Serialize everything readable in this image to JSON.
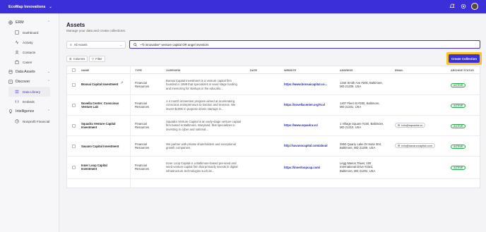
{
  "topbar": {
    "org_name": "EcoMap Innovations",
    "brand_color": "#3b2fd9"
  },
  "sidebar": {
    "sections": [
      {
        "label": "ERM",
        "icon": "globe-icon",
        "items": [
          {
            "label": "Dashboard",
            "icon": "dashboard-icon"
          },
          {
            "label": "Activity",
            "icon": "activity-icon"
          },
          {
            "label": "Contacts",
            "icon": "contacts-icon"
          },
          {
            "label": "Cases",
            "icon": "cases-icon"
          }
        ]
      },
      {
        "label": "Data Assets",
        "icon": "database-icon",
        "items": []
      },
      {
        "label": "Discover",
        "icon": "discover-icon",
        "items": [
          {
            "label": "Data Library",
            "icon": "library-icon",
            "active": true
          },
          {
            "label": "Embeds",
            "icon": "embed-icon"
          }
        ]
      },
      {
        "label": "Intelligence",
        "icon": "bulb-icon",
        "items": [
          {
            "label": "Nonprofit Financial",
            "icon": "chart-icon"
          }
        ]
      }
    ]
  },
  "page": {
    "title": "Assets",
    "subtitle": "Manage your data and create collections."
  },
  "filter": {
    "selected": "All Assets"
  },
  "search": {
    "value": "~\"b innovative\" venture capital OR angel investors"
  },
  "toolbar": {
    "columns_label": "Columns",
    "filter_label": "Filter",
    "create_label": "Create Collection"
  },
  "table": {
    "headers": {
      "name": "NAME",
      "type": "TYPE",
      "overview": "OVERVIEW",
      "date": "DATE",
      "website": "WEBSITE",
      "address": "ADDRESS",
      "email": "EMAIL",
      "status": "ARCHIVE STATUS"
    },
    "rows": [
      {
        "name": "Bonsai Capital Investment",
        "type": "Financial Resources",
        "overview": "Bonsai Capital Investment is a venture capital firm founded in 1999 that specializes in seed stage funding and mentoring for startups in the educatio...",
        "website": "https://www.bonsaicapital.co...",
        "address": "1340 Smith Ave #200, Baltimore, MD 21209, USA",
        "email": "",
        "status": "ACTIVE"
      },
      {
        "name": "Novella Center: Conscious Venture Lab",
        "type": "Financial Resources",
        "overview": "A 4 month immersion program aimed at accelerating conscious entrepreneurs to traction and revenue. We invest $100K in purpose driven startups in...",
        "website": "https://novellacenter.org/#cvl",
        "address": "1407 Fleet St #200, Baltimore, MD 21231, USA",
        "email": "",
        "status": "ACTIVE"
      },
      {
        "name": "Squadra Venture Capital Investment",
        "type": "Financial Resources",
        "overview": "Squadra Venture Capital is an early-stage venture capital firm based in Baltimore, Maryland, that specializes in investing in cyber and national...",
        "website": "https://www.squadra.vc/",
        "address": "1 Village Square #150, Baltimore, MD 21210, USA",
        "email": "info@squadra.vc",
        "status": "ACTIVE"
      },
      {
        "name": "Savano Capital Investment",
        "type": "Financial Resources",
        "overview": "We partner with private shareholders and exceptional growth companies.",
        "website": "http://savanocapital.com/about",
        "address": "2850 Quarry Lake Dr Suite 304, Baltimore, MD 21209, USA",
        "email": "info@savanocapital.com",
        "status": "ACTIVE"
      },
      {
        "name": "Inner Loop Capital Investment",
        "type": "Financial Resources",
        "overview": "Inner Loop Capital is a Baltimore-based pre-seed and seed venture capital firm that primarily invests in digital infrastructure technologies such as...",
        "website": "https://innerloopcap.com/",
        "address": "Legg Mason Tower, 100 International Drive #23rd, Baltimore, MD 21202, USA",
        "email": "",
        "status": "ACTIVE"
      }
    ]
  },
  "colors": {
    "accent": "#3b2fd9",
    "highlight": "#f6c32b",
    "active_status": "#2ea44f"
  }
}
